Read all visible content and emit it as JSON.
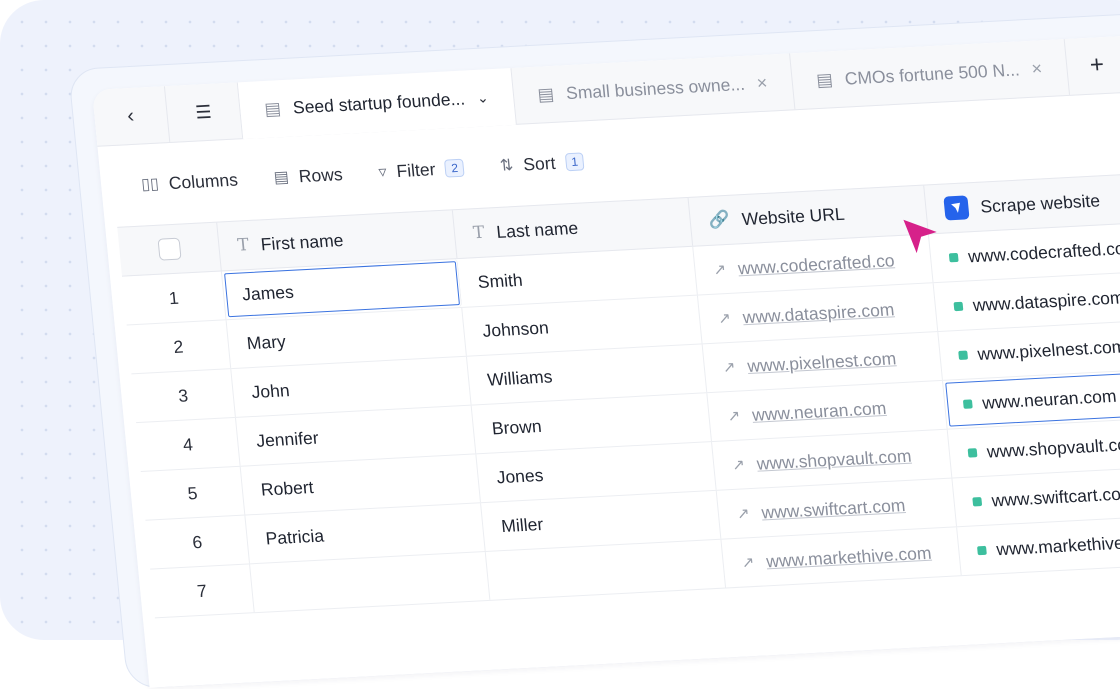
{
  "tabs": [
    {
      "label": "Seed startup founde...",
      "active": true
    },
    {
      "label": "Small business owne...",
      "active": false
    },
    {
      "label": "CMOs fortune 500 N...",
      "active": false
    }
  ],
  "toolbar": {
    "columns_label": "Columns",
    "rows_label": "Rows",
    "filter_label": "Filter",
    "filter_count": "2",
    "sort_label": "Sort",
    "sort_count": "1"
  },
  "columns": {
    "first_name": "First name",
    "last_name": "Last name",
    "website_url": "Website URL",
    "scrape_website": "Scrape website"
  },
  "rows": [
    {
      "num": "1",
      "first": "James",
      "last": "Smith",
      "url": "www.codecrafted.co",
      "scrape": "www.codecrafted.co"
    },
    {
      "num": "2",
      "first": "Mary",
      "last": "Johnson",
      "url": "www.dataspire.com",
      "scrape": "www.dataspire.com"
    },
    {
      "num": "3",
      "first": "John",
      "last": "Williams",
      "url": "www.pixelnest.com",
      "scrape": "www.pixelnest.com"
    },
    {
      "num": "4",
      "first": "Jennifer",
      "last": "Brown",
      "url": "www.neuran.com",
      "scrape": "www.neuran.com"
    },
    {
      "num": "5",
      "first": "Robert",
      "last": "Jones",
      "url": "www.shopvault.com",
      "scrape": "www.shopvault.com"
    },
    {
      "num": "6",
      "first": "Patricia",
      "last": "Miller",
      "url": "www.swiftcart.com",
      "scrape": "www.swiftcart.com"
    },
    {
      "num": "7",
      "first": "",
      "last": "",
      "url": "www.markethive.com",
      "scrape": "www.markethive.com"
    }
  ],
  "colors": {
    "accent": "#3b73e0",
    "cursor": "#d6218a",
    "status_dot": "#3dbf9e"
  }
}
